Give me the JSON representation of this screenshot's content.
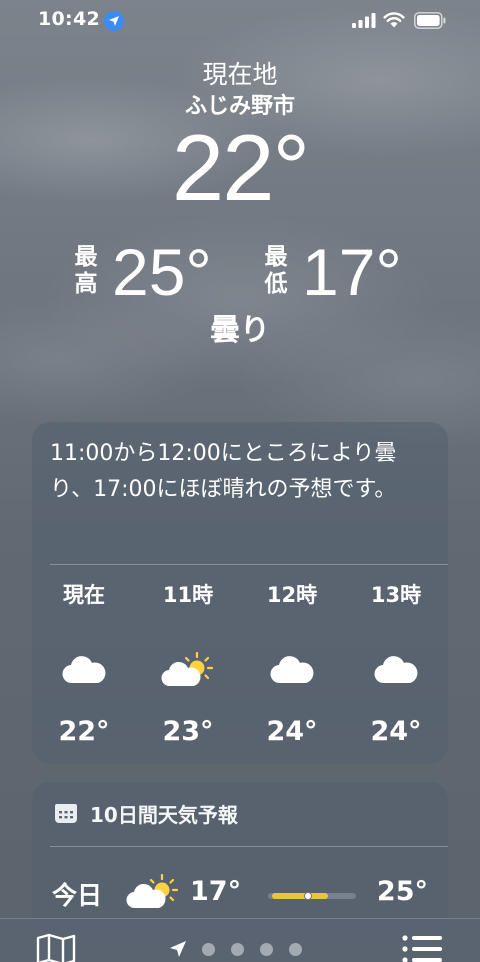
{
  "status_bar": {
    "time": "10:42",
    "icons": [
      "location-arrow-icon",
      "cellular-signal-icon",
      "wifi-icon",
      "battery-icon"
    ]
  },
  "location": {
    "title": "現在地",
    "city": "ふじみ野市"
  },
  "current": {
    "temperature": "22°",
    "high_label": "最高",
    "high": "25°",
    "low_label": "最低",
    "low": "17°",
    "condition": "曇り"
  },
  "hourly_card": {
    "summary": "11:00から12:00にところにより曇り、17:00にほぼ晴れの予想です。",
    "hours": [
      {
        "label": "現在",
        "icon": "cloud-icon",
        "temp": "22°"
      },
      {
        "label": "11時",
        "icon": "sun-behind-cloud-icon",
        "temp": "23°"
      },
      {
        "label": "12時",
        "icon": "cloud-icon",
        "temp": "24°"
      },
      {
        "label": "13時",
        "icon": "cloud-icon",
        "temp": "24°"
      }
    ]
  },
  "forecast_card": {
    "title": "10日間天気予報",
    "icon": "calendar-icon",
    "rows": [
      {
        "day": "今日",
        "icon": "sun-behind-cloud-icon",
        "low": "17°",
        "high": "25°",
        "current_marker": 0.45
      }
    ]
  },
  "toolbar": {
    "icons": [
      "map-icon",
      "location-arrow-icon",
      "list-icon"
    ],
    "page_count": 4
  },
  "colors": {
    "accent_blue": "#3b8cf2",
    "temp_bar": "#e8c53a"
  }
}
